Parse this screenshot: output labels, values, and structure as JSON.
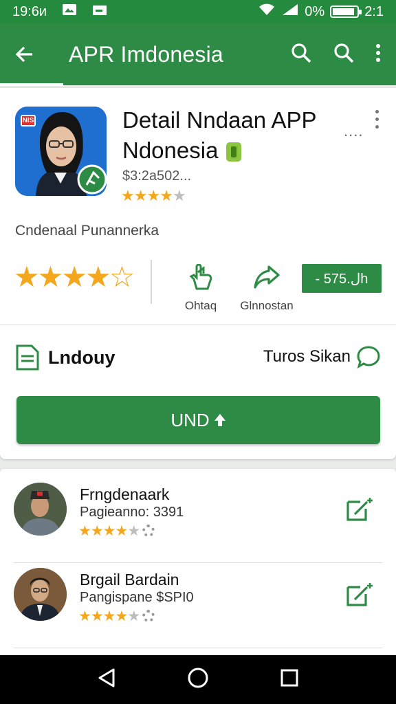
{
  "status_bar": {
    "time": "19:6и",
    "battery_text": "0%",
    "clock_right": "2:1",
    "battery_level": 0.9
  },
  "app_bar": {
    "title": "APR Imdonesia"
  },
  "app": {
    "title_line1": "Detail Nndaan APP",
    "title_line2": "Ndonesia",
    "dots_text": "....",
    "subtitle": "$3:2а502...",
    "stars": 4,
    "icon_badge": "NIS",
    "description": "Cndenaal Punannerka",
    "big_stars": 4.5
  },
  "actions": [
    {
      "label": "Ohtaq"
    },
    {
      "label": "Glnnostan"
    }
  ],
  "price_button": "- 575.لh",
  "section": {
    "title": "Lndouy",
    "link": "Turos Sikan"
  },
  "main_button": {
    "label": "UND"
  },
  "reviews": [
    {
      "name": "Frngdenaark",
      "subtitle": "Pagieanno: 3391",
      "stars": 4
    },
    {
      "name": "Brgail Bardain",
      "subtitle": "Pangispane $SPI0",
      "stars": 4
    }
  ],
  "colors": {
    "primary": "#2e8b45",
    "star": "#f4a71c"
  }
}
